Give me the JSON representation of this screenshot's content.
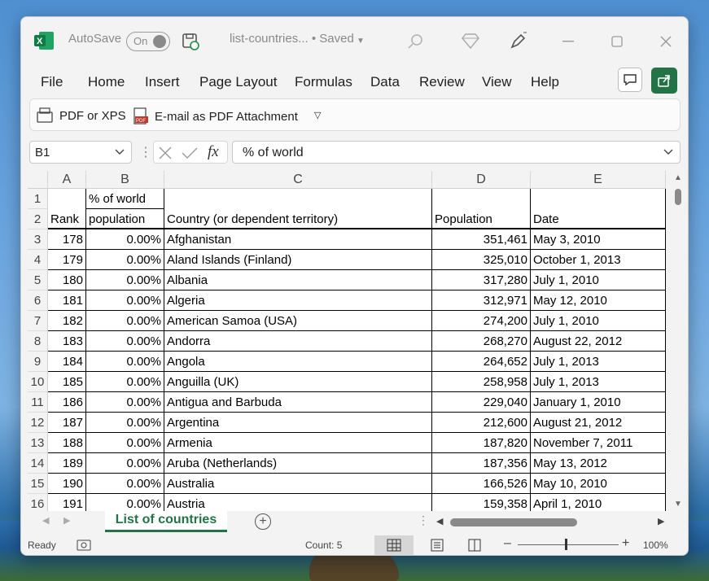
{
  "titlebar": {
    "autosave_label": "AutoSave",
    "toggle_label": "On",
    "doc_title": "list-countries... • Saved",
    "app_icon": "excel-icon",
    "icons": [
      "save-icon",
      "search-icon",
      "diamond-icon",
      "pen-icon",
      "maximize-icon",
      "close-icon"
    ]
  },
  "menu": {
    "items": [
      "File",
      "Home",
      "Insert",
      "Page Layout",
      "Formulas",
      "Data",
      "Review",
      "View",
      "Help"
    ]
  },
  "ribbon": {
    "pdf_xps": "PDF or XPS",
    "email_pdf": "E-mail as PDF Attachment"
  },
  "formula_bar": {
    "name_box": "B1",
    "fx_label": "fx",
    "value": "% of world"
  },
  "grid": {
    "columns": [
      "A",
      "B",
      "C",
      "D",
      "E"
    ],
    "row_numbers": [
      "1",
      "2",
      "3",
      "4",
      "5",
      "6",
      "7",
      "8",
      "9",
      "10",
      "11",
      "12",
      "13",
      "14",
      "15",
      "16"
    ],
    "header_row1": {
      "B": "% of world"
    },
    "header_row2": {
      "A": "Rank",
      "B": "population",
      "C": "Country (or dependent territory)",
      "D": "Population",
      "E": "Date"
    },
    "rows": [
      [
        "178",
        "0.00%",
        "Afghanistan",
        "351,461",
        "May 3, 2010"
      ],
      [
        "179",
        "0.00%",
        "Aland Islands (Finland)",
        "325,010",
        "October 1, 2013"
      ],
      [
        "180",
        "0.00%",
        "Albania",
        "317,280",
        "July 1, 2010"
      ],
      [
        "181",
        "0.00%",
        "Algeria",
        "312,971",
        "May 12, 2010"
      ],
      [
        "182",
        "0.00%",
        "American Samoa (USA)",
        "274,200",
        "July 1, 2010"
      ],
      [
        "183",
        "0.00%",
        "Andorra",
        "268,270",
        "August 22, 2012"
      ],
      [
        "184",
        "0.00%",
        "Angola",
        "264,652",
        "July 1, 2013"
      ],
      [
        "185",
        "0.00%",
        "Anguilla (UK)",
        "258,958",
        "July 1, 2013"
      ],
      [
        "186",
        "0.00%",
        "Antigua and Barbuda",
        "229,040",
        "January 1, 2010"
      ],
      [
        "187",
        "0.00%",
        "Argentina",
        "212,600",
        "August 21, 2012"
      ],
      [
        "188",
        "0.00%",
        "Armenia",
        "187,820",
        "November 7, 2011"
      ],
      [
        "189",
        "0.00%",
        "Aruba (Netherlands)",
        "187,356",
        "May 13, 2012"
      ],
      [
        "190",
        "0.00%",
        "Australia",
        "166,526",
        "May 10, 2010"
      ],
      [
        "191",
        "0.00%",
        "Austria",
        "159,358",
        "April 1, 2010"
      ]
    ]
  },
  "sheets": {
    "active": "List of countries"
  },
  "status": {
    "ready": "Ready",
    "count": "Count: 5",
    "zoom": "100%"
  },
  "colors": {
    "accent": "#237346",
    "window_bg": "#f3f3f3"
  }
}
